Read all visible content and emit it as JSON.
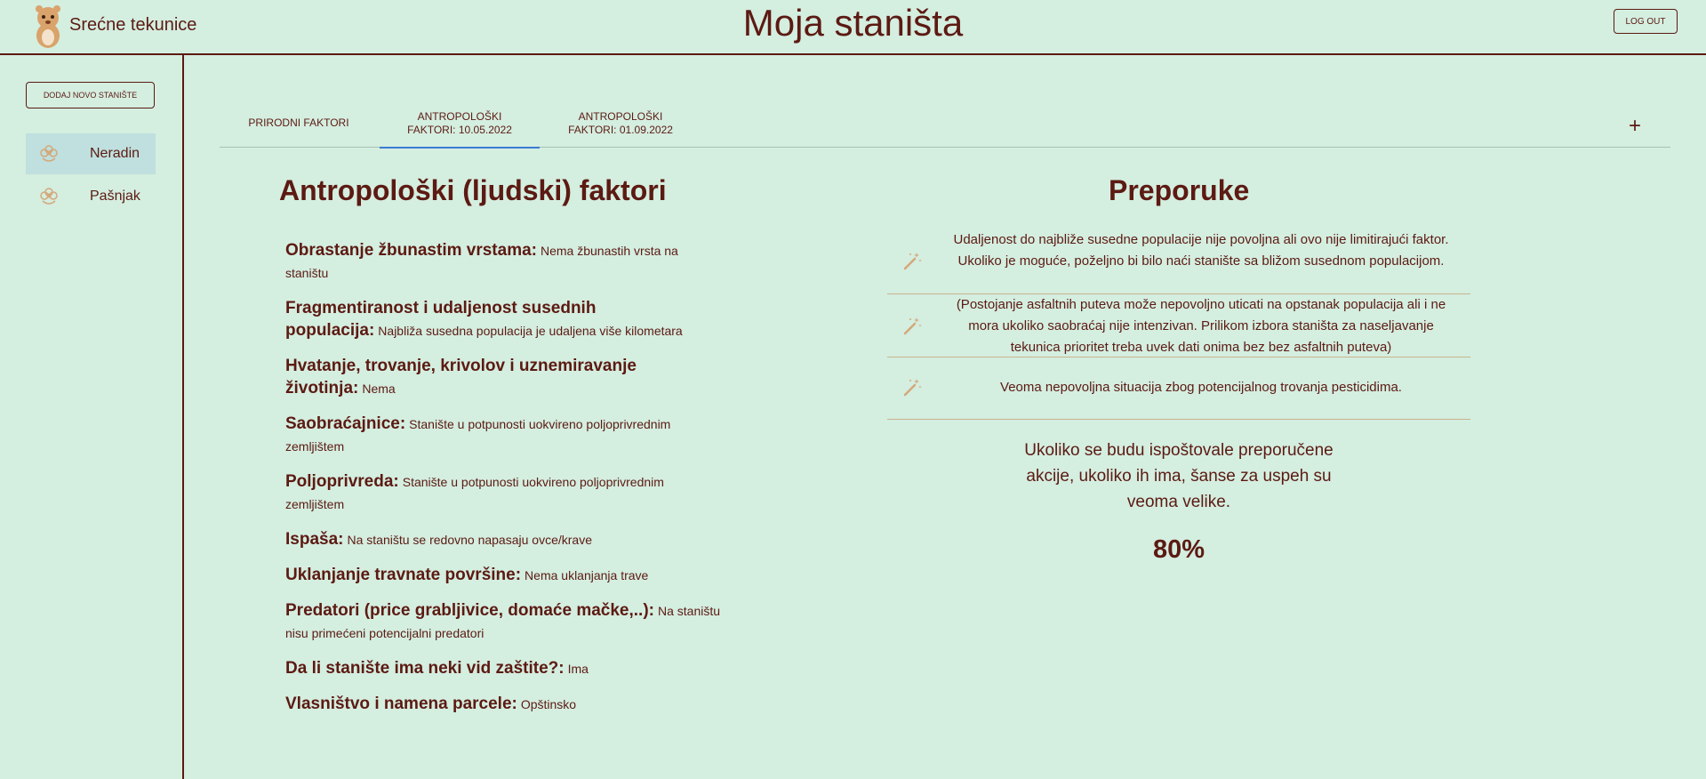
{
  "header": {
    "app_name": "Srećne tekunice",
    "page_title": "Moja staništa",
    "logout_label": "LOG OUT"
  },
  "sidebar": {
    "add_label": "DODAJ NOVO STANIŠTE",
    "items": [
      {
        "label": "Neradin",
        "active": true
      },
      {
        "label": "Pašnjak",
        "active": false
      }
    ]
  },
  "tabs": [
    {
      "line1": "PRIRODNI FAKTORI",
      "line2": ""
    },
    {
      "line1": "ANTROPOLOŠKI",
      "line2": "FAKTORI: 10.05.2022"
    },
    {
      "line1": "ANTROPOLOŠKI",
      "line2": "FAKTORI: 01.09.2022"
    }
  ],
  "add_tab_symbol": "+",
  "factors": {
    "title": "Antropološki (ljudski) faktori",
    "items": [
      {
        "label": "Obrastanje žbunastim vrstama:",
        "value": "Nema žbunastih vrsta na staništu"
      },
      {
        "label": "Fragmentiranost i udaljenost susednih populacija:",
        "value": "Najbliža susedna populacija je udaljena više kilometara"
      },
      {
        "label": "Hvatanje, trovanje, krivolov i uznemiravanje životinja:",
        "value": "Nema"
      },
      {
        "label": "Saobraćajnice:",
        "value": "Stanište u potpunosti uokvireno poljoprivrednim zemljištem"
      },
      {
        "label": "Poljoprivreda:",
        "value": "Stanište u potpunosti uokvireno poljoprivrednim zemljištem"
      },
      {
        "label": "Ispaša:",
        "value": "Na staništu se redovno napasaju ovce/krave"
      },
      {
        "label": "Uklanjanje travnate površine:",
        "value": "Nema uklanjanja trave"
      },
      {
        "label": "Predatori (price grabljivice, domaće mačke,..):",
        "value": "Na staništu nisu primećeni potencijalni predatori"
      },
      {
        "label": "Da li stanište ima neki vid zaštite?:",
        "value": "Ima"
      },
      {
        "label": "Vlasništvo i namena parcele:",
        "value": "Opštinsko"
      }
    ]
  },
  "recommendations": {
    "title": "Preporuke",
    "items": [
      {
        "text": "Udaljenost do najbliže susedne populacije nije povoljna ali ovo nije limitirajući faktor. Ukoliko je moguće, poželjno bi bilo naći stanište sa bližom susednom populacijom."
      },
      {
        "text": "(Postojanje asfaltnih puteva može nepovoljno uticati na opstanak populacija ali i ne mora ukoliko saobraćaj nije intenzivan. Prilikom izbora staništa za naseljavanje tekunica prioritet treba uvek dati onima bez bez asfaltnih puteva)"
      },
      {
        "text": "Veoma nepovoljna situacija zbog potencijalnog trovanja pesticidima."
      }
    ],
    "summary": "Ukoliko se budu ispoštovale preporučene akcije, ukoliko ih ima, šanse za uspeh su veoma velike.",
    "success_chance": "80%"
  },
  "colors": {
    "background": "#d4eee0",
    "text": "#5c1a12",
    "active_tab_underline": "#3a7bd5",
    "active_sidebar_bg": "#bfe0de",
    "icon": "#d4a87a"
  },
  "icons": {
    "logo": "squirrel-logo",
    "sidebar_item": "flower-icon",
    "recommendation": "magic-wand-icon"
  }
}
